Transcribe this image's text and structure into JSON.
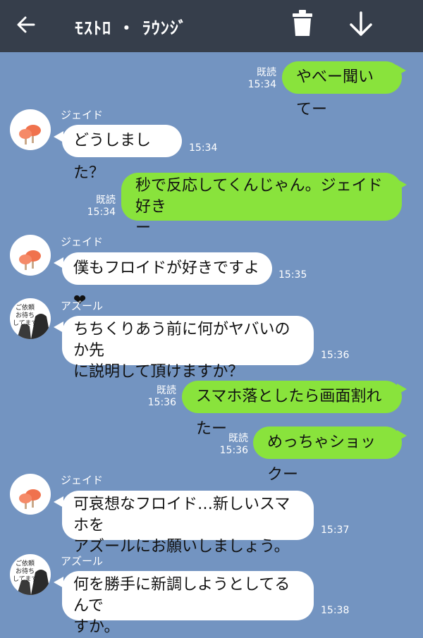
{
  "header": {
    "title": "ﾓｽﾄﾛ ・ ﾗｳﾝｼﾞ",
    "back_icon": "back-arrow-icon",
    "trash_icon": "trash-icon",
    "download_icon": "down-arrow-icon"
  },
  "colors": {
    "background": "#7394c1",
    "header": "#363e4b",
    "outgoing_bubble": "#89e33c",
    "incoming_bubble": "#ffffff"
  },
  "messages": [
    {
      "direction": "out",
      "text": "やべー聞いてー",
      "read": "既読",
      "time": "15:34"
    },
    {
      "direction": "in",
      "sender": "ジェイド",
      "avatar": "mushroom-avatar",
      "text": "どうしました？",
      "time": "15:34"
    },
    {
      "direction": "out",
      "text": "秒で反応してくんじゃん。ジェイド好き\nー",
      "read": "既読",
      "time": "15:34"
    },
    {
      "direction": "in",
      "sender": "ジェイド",
      "avatar": "mushroom-avatar",
      "text": "僕もフロイドが好きですよ❤",
      "time": "15:35"
    },
    {
      "direction": "in",
      "sender": "アズール",
      "avatar": "azul-avatar",
      "avatar_text": "ご依頼\nお待ち\nしてます",
      "text": "ちちくりあう前に何がヤバいのか先\nに説明して頂けますか？",
      "time": "15:36"
    },
    {
      "direction": "out",
      "text": "スマホ落としたら画面割れたー",
      "read": "既読",
      "time": "15:36"
    },
    {
      "direction": "out",
      "text": "めっちゃショックー",
      "read": "既読",
      "time": "15:36"
    },
    {
      "direction": "in",
      "sender": "ジェイド",
      "avatar": "mushroom-avatar",
      "text": "可哀想なフロイド…新しいスマホを\nアズールにお願いしましょう。",
      "time": "15:37"
    },
    {
      "direction": "in",
      "sender": "アズール",
      "avatar": "azul-avatar",
      "avatar_text": "ご依頼\nお待ち\nしてます",
      "text": "何を勝手に新調しようとしてるんで\nすか。",
      "time": "15:38"
    }
  ]
}
